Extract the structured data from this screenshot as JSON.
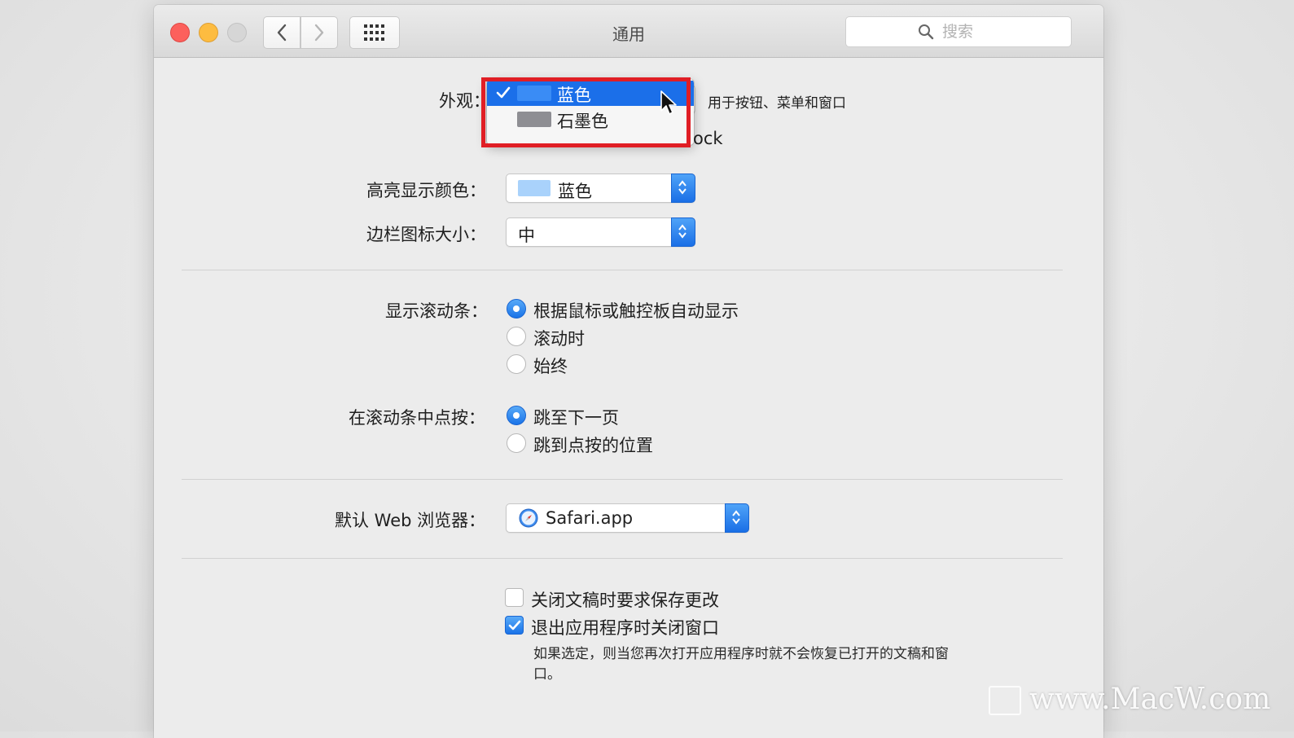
{
  "window": {
    "title": "通用",
    "search_placeholder": "搜索"
  },
  "appearance": {
    "label": "外观：",
    "description": "用于按钮、菜单和窗口",
    "hidden_text_fragment": "ock",
    "menu": {
      "options": [
        {
          "label": "蓝色",
          "swatch_color": "#3a8cf5",
          "selected": true
        },
        {
          "label": "石墨色",
          "swatch_color": "#8e8e93",
          "selected": false
        }
      ]
    }
  },
  "highlight": {
    "label": "高亮显示颜色：",
    "value": "蓝色",
    "swatch_color": "#a9d2fb"
  },
  "sidebar_icon_size": {
    "label": "边栏图标大小：",
    "value": "中"
  },
  "scrollbars": {
    "label": "显示滚动条：",
    "options": [
      {
        "label": "根据鼠标或触控板自动显示",
        "selected": true
      },
      {
        "label": "滚动时",
        "selected": false
      },
      {
        "label": "始终",
        "selected": false
      }
    ]
  },
  "click_in_scrollbar": {
    "label": "在滚动条中点按：",
    "options": [
      {
        "label": "跳至下一页",
        "selected": true
      },
      {
        "label": "跳到点按的位置",
        "selected": false
      }
    ]
  },
  "default_browser": {
    "label": "默认 Web 浏览器：",
    "value": "Safari.app"
  },
  "checkboxes": [
    {
      "label": "关闭文稿时要求保存更改",
      "checked": false
    },
    {
      "label": "退出应用程序时关闭窗口",
      "checked": true
    }
  ],
  "close_windows_note": "如果选定，则当您再次打开应用程序时就不会恢复已打开的文稿和窗口。",
  "watermark": "www.MacW.com",
  "colors": {
    "accent": "#1b6fe9",
    "highlight_box": "#e01e25"
  }
}
